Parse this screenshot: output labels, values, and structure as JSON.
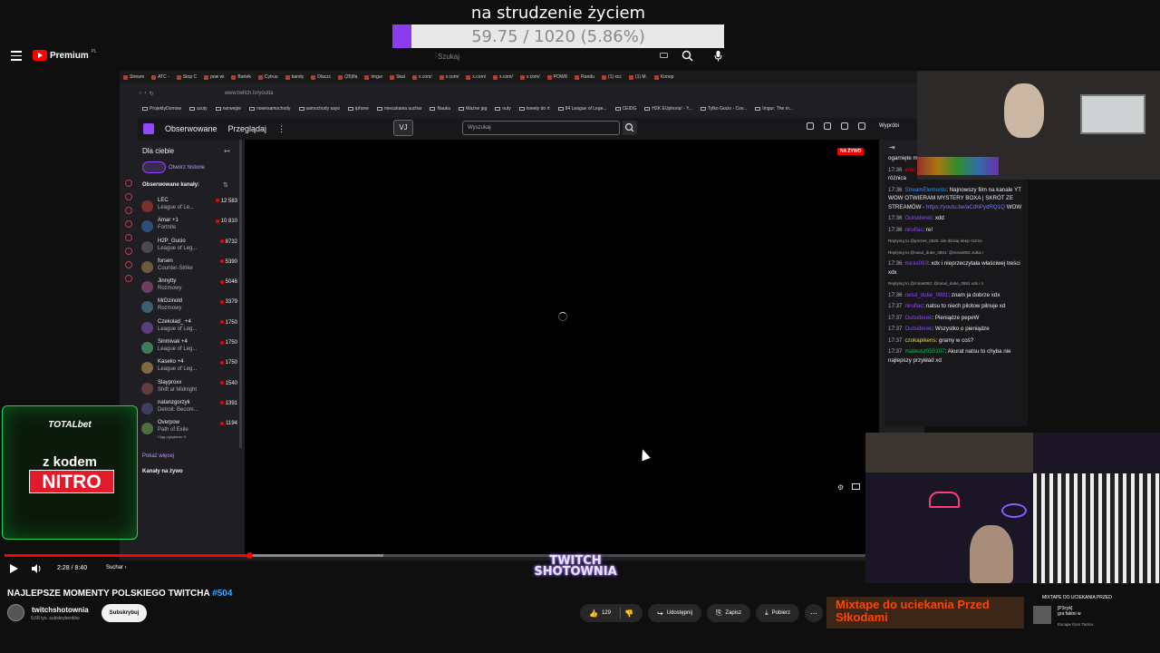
{
  "goal": {
    "title": "na strudzenie życiem",
    "progress_text": "59.75 / 1020 (5.86%)",
    "fraction": 0.0586,
    "fill_color": "#8a3cf0"
  },
  "youtube": {
    "logo": "Premium",
    "logo_region": "PL",
    "search_placeholder": "Szukaj"
  },
  "browser": {
    "tabs": [
      "Stream",
      "ATC -",
      "Stop C",
      "pow wi",
      "Bartek",
      "Cytruu",
      "bandy",
      "Dlaczc",
      "(25)fla",
      "Imgur",
      "Skal",
      "x.com/",
      "x.com/",
      "x.com/",
      "x.com/",
      "x.com/",
      "POWR",
      "Randu",
      "(1) xcc",
      "(1) M.",
      "Konop"
    ],
    "url": "www.twitch.tv/youtla",
    "bookmarks": [
      "ProjektyDomow",
      "szuty",
      "norwegie",
      "nowesamochody",
      "samochody xayo",
      "iphone",
      "mieszkania suchar",
      "Nauka",
      "Ważne jpg",
      "nuty",
      "tweety do rt",
      "84 League of Lege...",
      "CEIDG",
      "H2K EUphoria! - Y...",
      "Tylko Gucio - Cov...",
      "Imgur: The m..."
    ]
  },
  "twitch": {
    "nav_followed": "Obserwowane",
    "nav_browse": "Przeglądaj",
    "vj_label": "VJ",
    "search_placeholder": "Wyszukaj",
    "prime_label": "Wypróbi",
    "sidebar": {
      "header": "Dla ciebie",
      "history_button": "Otwórz historie",
      "followed_header": "Obserwowane kanały:",
      "channels": [
        {
          "name": "LEC",
          "game": "League of Le...",
          "viewers": "12 583"
        },
        {
          "name": "Amar +1",
          "game": "Fortnite",
          "viewers": "10 810"
        },
        {
          "name": "H2P_Gucio",
          "game": "League of Leg...",
          "viewers": "8732"
        },
        {
          "name": "forsen",
          "game": "Counter-Strike",
          "viewers": "5390"
        },
        {
          "name": "Jinnytty",
          "game": "Rozmowy",
          "viewers": "5046"
        },
        {
          "name": "MrDzinold",
          "game": "Rozmowy",
          "viewers": "3379"
        },
        {
          "name": "Czekolad_ +4",
          "game": "League of Leg...",
          "viewers": "1750"
        },
        {
          "name": "Sinmivak +4",
          "game": "League of Leg...",
          "viewers": "1750"
        },
        {
          "name": "Kaseko +4",
          "game": "League of Leg...",
          "viewers": "1750"
        },
        {
          "name": "Slayproxx",
          "game": "Shift at Midnight",
          "viewers": "1540"
        },
        {
          "name": "natanzgorzyk",
          "game": "Detroit: Becom...",
          "viewers": "1391"
        },
        {
          "name": "Overpow",
          "game": "Path of Exile",
          "viewers": "1194",
          "extra": "Ciąg oglądania: 5"
        }
      ],
      "show_more": "Pokaż więcej",
      "live_channels": "Kanały na żywo"
    },
    "live_badge": "NA ŻYWO"
  },
  "chat": {
    "messages": [
      {
        "reply": "",
        "time": "",
        "user": "",
        "user_class": "",
        "text": "ogarnięte mężczyzn"
      },
      {
        "reply": "",
        "time": "17:36",
        "user": "emil_mwa",
        "user_class": "u-red",
        "text": "dobrymi czy beciakami? bo to też różnica"
      },
      {
        "reply": "",
        "time": "17:36",
        "user": "StreamElements",
        "user_class": "u-blue",
        "text": "Najnowszy film na kanale YT WOW OTWIERAM MYSTERY BOXA | SKRÓT ZE STREAMÓW -",
        "link": "https://youtu.be/aCdhPydRQ1Q",
        "link_suffix": " WOW"
      },
      {
        "reply": "",
        "time": "17:36",
        "user": "Outsiderek",
        "user_class": "u-purple",
        "text": "xdd"
      },
      {
        "reply": "",
        "time": "17:36",
        "user": "niruflac",
        "user_class": "u-purple",
        "text": "re!"
      },
      {
        "reply": "Replying to @prezes_0625: ale dzisiaj deep rozmo",
        "time": "",
        "user": "",
        "user_class": "",
        "text": ""
      },
      {
        "reply": "Replying to @raoul_duke_0891: @miras093 Julka r",
        "time": "17:36",
        "user": "miras093",
        "user_class": "u-purple",
        "text": "xdx i nieprzeczytała właściwej treści xdx"
      },
      {
        "reply": "Replying to @miras093: @raoul_duke_0891 xdx i n",
        "time": "17:36",
        "user": "raoul_duke_0891",
        "user_class": "u-purple",
        "text": "znam ja dobrze xdx"
      },
      {
        "reply": "",
        "time": "17:37",
        "user": "niruflac",
        "user_class": "u-purple",
        "text": "natsu to niech pilotow pilnuje xd"
      },
      {
        "reply": "",
        "time": "17:37",
        "user": "Outsiderek",
        "user_class": "u-purple",
        "text": "Pieniądze pepeW"
      },
      {
        "reply": "",
        "time": "17:37",
        "user": "Outsiderek",
        "user_class": "u-purple",
        "text": "Wszystko o pieniądze"
      },
      {
        "reply": "",
        "time": "17:37",
        "user": "czokapikens",
        "user_class": "u-yellow",
        "text": "gramy w coś?"
      },
      {
        "reply": "",
        "time": "17:37",
        "user": "mateusz050107",
        "user_class": "u-green",
        "text": "Akurat natsu to chyba nie najlepszy przykład xd"
      }
    ]
  },
  "sponsor": {
    "brand": "TOTALbet",
    "line1": "z kodem",
    "line2": "NITRO",
    "accent": "#2ccf58"
  },
  "player": {
    "time": "2:28 / 8:40",
    "chapter": "Suchar",
    "progress_fraction": 0.2846,
    "banner": "TWITCH\nSHOTOWNIA"
  },
  "video": {
    "title": "NAJLEPSZE MOMENTY POLSKIEGO TWITCHA",
    "hashtag": "#504",
    "channel": "twitchshotownia",
    "subscribers": "9,68 tys. subskrybentów",
    "subscribe": "Subskrybuj",
    "likes": "129",
    "share": "Udostępnij",
    "save": "Zapisz",
    "download": "Pobierz"
  },
  "recommended": {
    "thumb_text": "Mixtape do uciekania Przed Słkodami",
    "title": "MIXTAPE DO UCIEKANIA PRZED",
    "channel": "[P3cyk]",
    "desc": "gra faktni w",
    "game": "Escape from Tarkov"
  }
}
